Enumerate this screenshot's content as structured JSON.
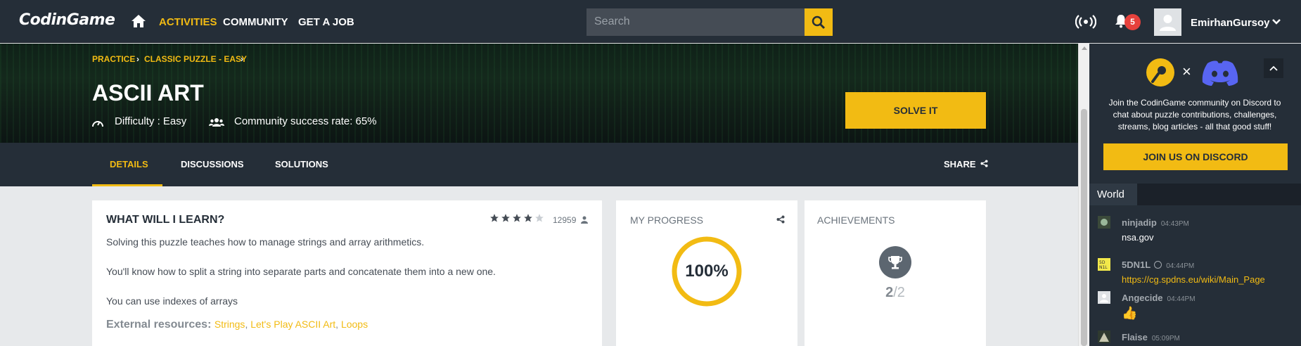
{
  "topbar": {
    "logo_main": "CodinGame",
    "nav": [
      "ACTIVITIES",
      "COMMUNITY",
      "GET A JOB"
    ],
    "search_placeholder": "Search",
    "notification_count": "5",
    "username": "EmirhanGursoy"
  },
  "puzzle": {
    "breadcrumb": [
      "PRACTICE",
      "CLASSIC PUZZLE - EASY"
    ],
    "title": "ASCII ART",
    "difficulty": "Difficulty : Easy",
    "success_rate": "Community success rate: 65%",
    "solve_label": "SOLVE IT"
  },
  "tabs": {
    "items": [
      "DETAILS",
      "DISCUSSIONS",
      "SOLUTIONS"
    ],
    "share": "SHARE"
  },
  "learn": {
    "title": "WHAT WILL I LEARN?",
    "rating": 4,
    "rating_count": "12959",
    "paragraphs": [
      "Solving this puzzle teaches how to manage strings and array arithmetics.",
      "You'll know how to split a string into separate parts and concatenate them into a new one.",
      "You can use indexes of arrays"
    ],
    "resources_label": "External resources:",
    "resources": [
      "Strings",
      "Let's Play ASCII Art",
      "Loops"
    ]
  },
  "progress": {
    "label": "MY PROGRESS",
    "value": "100%"
  },
  "achievements": {
    "label": "ACHIEVEMENTS",
    "earned": "2",
    "total": "/2"
  },
  "chat": {
    "discord_text": "Join the CodinGame community on Discord to chat about puzzle contributions, challenges, streams, blog articles - all that good stuff!",
    "discord_button": "JOIN US ON DISCORD",
    "tab": "World",
    "messages": [
      {
        "user": "ninjadip",
        "time": "04:43PM",
        "text": "nsa.gov"
      },
      {
        "user": "5DN1L",
        "time": "04:44PM",
        "text": "https://cg.spdns.eu/wiki/Main_Page"
      },
      {
        "user": "Angecide",
        "time": "04:44PM",
        "text": "👍"
      },
      {
        "user": "Flaise",
        "time": "05:09PM",
        "text": ""
      }
    ]
  },
  "colors": {
    "accent": "#f2bb13",
    "navbar": "#252e38",
    "badge": "#e7413c",
    "discord": "#5865f2"
  }
}
